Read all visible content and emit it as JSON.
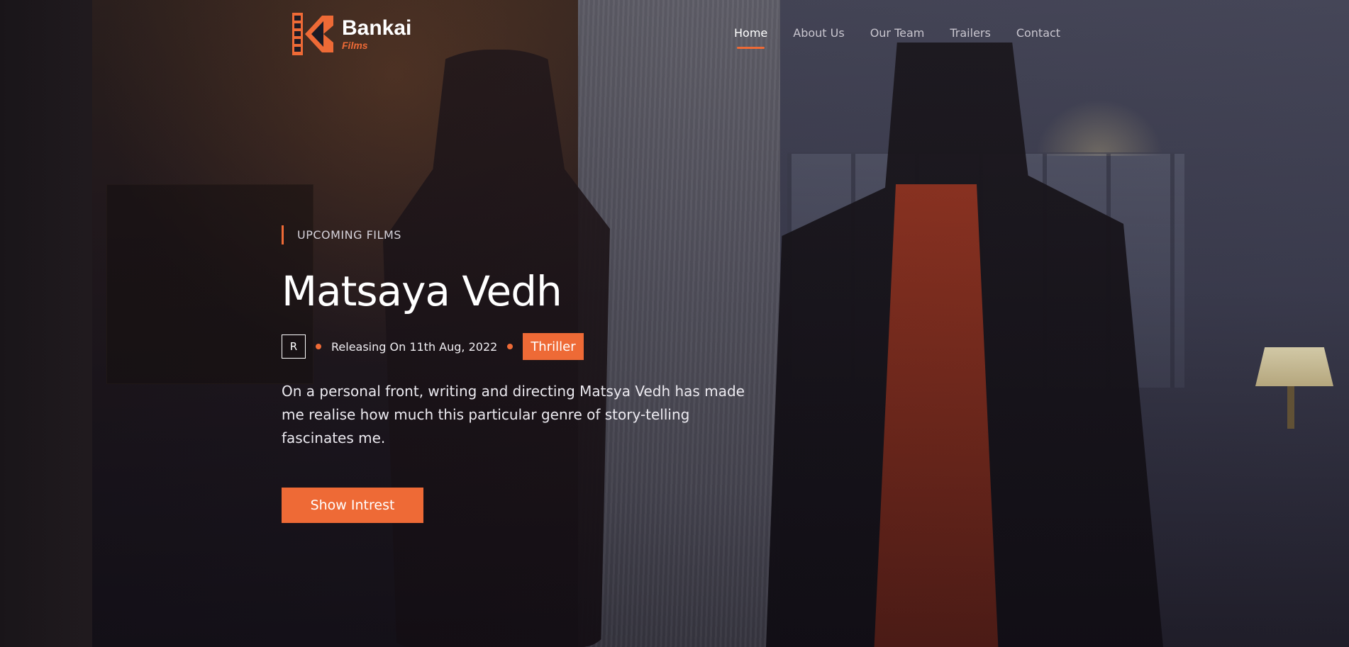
{
  "brand": {
    "name": "Bankai",
    "sub": "Films",
    "accent_color": "#ee6a36",
    "logo_icon": "film-strip-k-logo"
  },
  "nav": {
    "items": [
      {
        "label": "Home",
        "active": true
      },
      {
        "label": "About Us",
        "active": false
      },
      {
        "label": "Our Team",
        "active": false
      },
      {
        "label": "Trailers",
        "active": false
      },
      {
        "label": "Contact",
        "active": false
      }
    ]
  },
  "hero": {
    "eyebrow": "UPCOMING FILMS",
    "title": "Matsaya Vedh",
    "rating": "R",
    "release": "Releasing On 11th Aug, 2022",
    "genre": "Thriller",
    "description": "On a personal front, writing and directing Matsya Vedh has made me realise how much this particular genre of story-telling fascinates me.",
    "cta_label": "Show Intrest"
  }
}
